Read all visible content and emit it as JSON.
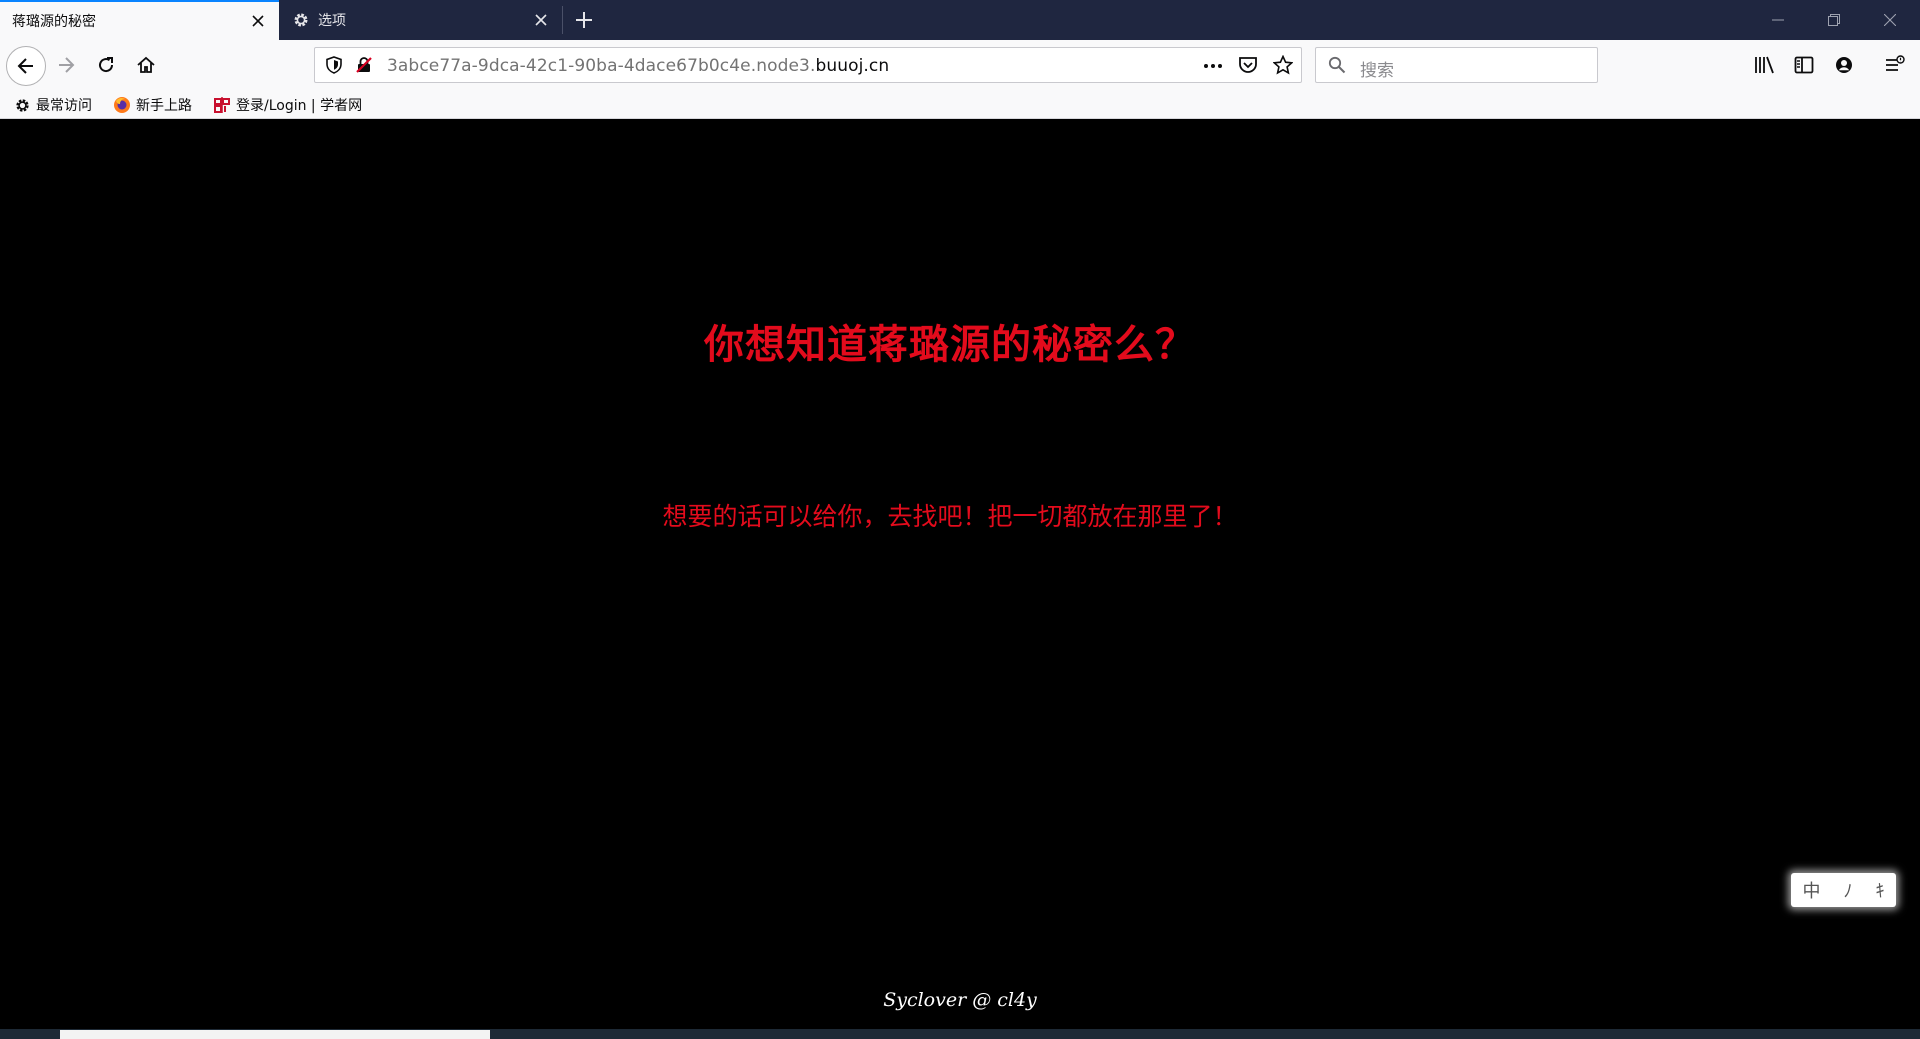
{
  "tabs": {
    "active_title": "蒋璐源的秘密",
    "inactive_title": "选项"
  },
  "navbar": {
    "url_prefix": "3abce77a-9dca-42c1-90ba-4dace67b0c4e.node3.",
    "url_host": "buuoj.cn",
    "search_placeholder": "搜索"
  },
  "bookmarks": [
    {
      "label": "最常访问",
      "icon": "gear-icon"
    },
    {
      "label": "新手上路",
      "icon": "firefox-icon"
    },
    {
      "label": "登录/Login | 学者网",
      "icon": "scholar-icon"
    }
  ],
  "page": {
    "heading": "你想知道蒋璐源的秘密么？",
    "subtext": "想要的话可以给你，去找吧！把一切都放在那里了！",
    "footer": "Syclover @ cl4y"
  },
  "ime": {
    "items": [
      "中",
      "ﾉ",
      "ｷ"
    ]
  },
  "colors": {
    "tabstrip_bg": "#1f2640",
    "accent_blue": "#0a84ff",
    "heading_red": "#e30b1c",
    "page_bg": "#000000"
  }
}
